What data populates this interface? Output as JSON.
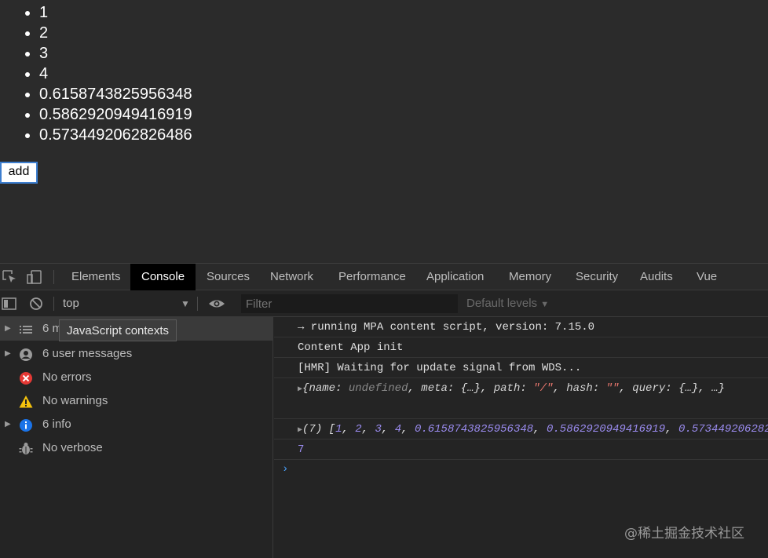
{
  "page": {
    "list_items": [
      "1",
      "2",
      "3",
      "4",
      "0.6158743825956348",
      "0.5862920949416919",
      "0.5734492062826486"
    ],
    "add_button_label": "add"
  },
  "devtools": {
    "tabs": [
      "Elements",
      "Console",
      "Sources",
      "Network",
      "Performance",
      "Application",
      "Memory",
      "Security",
      "Audits",
      "Vue"
    ],
    "active_tab": "Console",
    "toolbar": {
      "context": "top",
      "filter_placeholder": "Filter",
      "levels": "Default levels"
    },
    "sidebar": {
      "items": [
        {
          "label": "6 m",
          "icon": "list-icon",
          "expandable": true
        },
        {
          "label": "6 user messages",
          "icon": "user-icon",
          "expandable": true
        },
        {
          "label": "No errors",
          "icon": "error-icon",
          "expandable": false
        },
        {
          "label": "No warnings",
          "icon": "warning-icon",
          "expandable": false
        },
        {
          "label": "6 info",
          "icon": "info-icon",
          "expandable": true
        },
        {
          "label": "No verbose",
          "icon": "bug-icon",
          "expandable": false
        }
      ],
      "tooltip": "JavaScript contexts"
    },
    "console": {
      "lines": [
        "→ running MPA content script, version: 7.15.0",
        "Content App init",
        "[HMR] Waiting for update signal from WDS..."
      ],
      "object_log": {
        "name_key": "name",
        "name_val": "undefined",
        "meta_key": "meta",
        "meta_val": "{…}",
        "path_key": "path",
        "path_val": "\"/\"",
        "hash_key": "hash",
        "hash_val": "\"\"",
        "query_key": "query",
        "query_val": "{…}",
        "rest": "…"
      },
      "array_log": {
        "count": "(7)",
        "values": [
          "1",
          "2",
          "3",
          "4",
          "0.6158743825956348",
          "0.5862920949416919",
          "0.573449206282"
        ]
      },
      "result": "7"
    }
  },
  "watermark": "@稀土掘金技术社区",
  "colors": {
    "page_bg": "#2b2b2b",
    "active_tab_bg": "#000000",
    "number": "#9b8cf0",
    "string": "#e8766d",
    "error": "#e53935",
    "warning": "#f4c20d",
    "info": "#1a73e8"
  }
}
